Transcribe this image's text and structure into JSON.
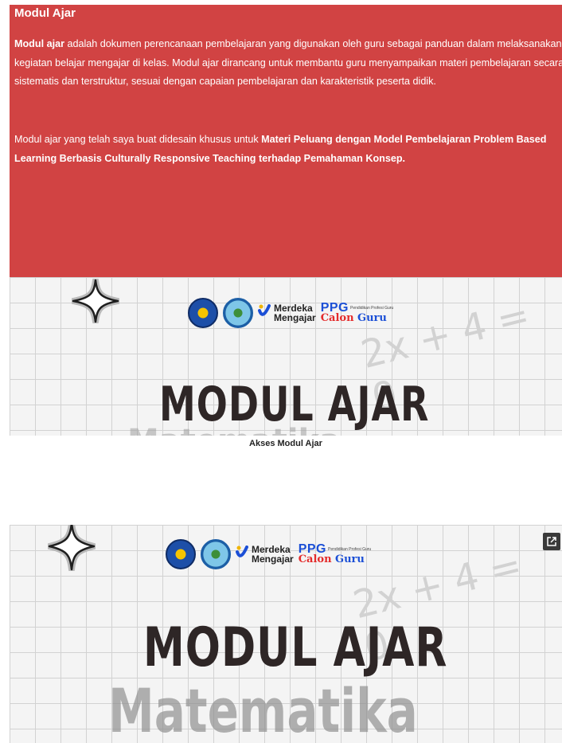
{
  "section": {
    "heading": "Modul Ajar",
    "para1_bold": "Modul ajar",
    "para1_rest": " adalah dokumen perencanaan pembelajaran yang digunakan oleh guru sebagai panduan dalam melaksanakan kegiatan belajar mengajar di kelas. Modul ajar dirancang untuk membantu guru menyampaikan materi pembelajaran secara sistematis dan terstruktur, sesuai dengan capaian pembelajaran dan karakteristik peserta didik.",
    "para2_start": "Modul ajar yang telah saya buat didesain khusus untuk ",
    "para2_bold": "Materi Peluang dengan Model Pembelajaran Problem Based Learning Berbasis Culturally Responsive Teaching terhadap Pemahaman Konsep.",
    "bg_color": "#d14343"
  },
  "banner": {
    "logo_mm_line1": "Merdeka",
    "logo_mm_line2": "Mengajar",
    "logo_ppg": "PPG",
    "logo_ppg_sub": "Pendidikan Profesi Guru",
    "logo_calon": "Calon",
    "logo_guru": "Guru",
    "title": "MODUL AJAR",
    "subtitle": "Matematika",
    "handwriting": "2x + 4 = 0"
  },
  "caption": "Akses Modul Ajar",
  "icons": [
    "sparkle-icon",
    "kemendikbud-logo",
    "university-logo",
    "merdeka-mengajar-logo",
    "external-link-icon"
  ]
}
